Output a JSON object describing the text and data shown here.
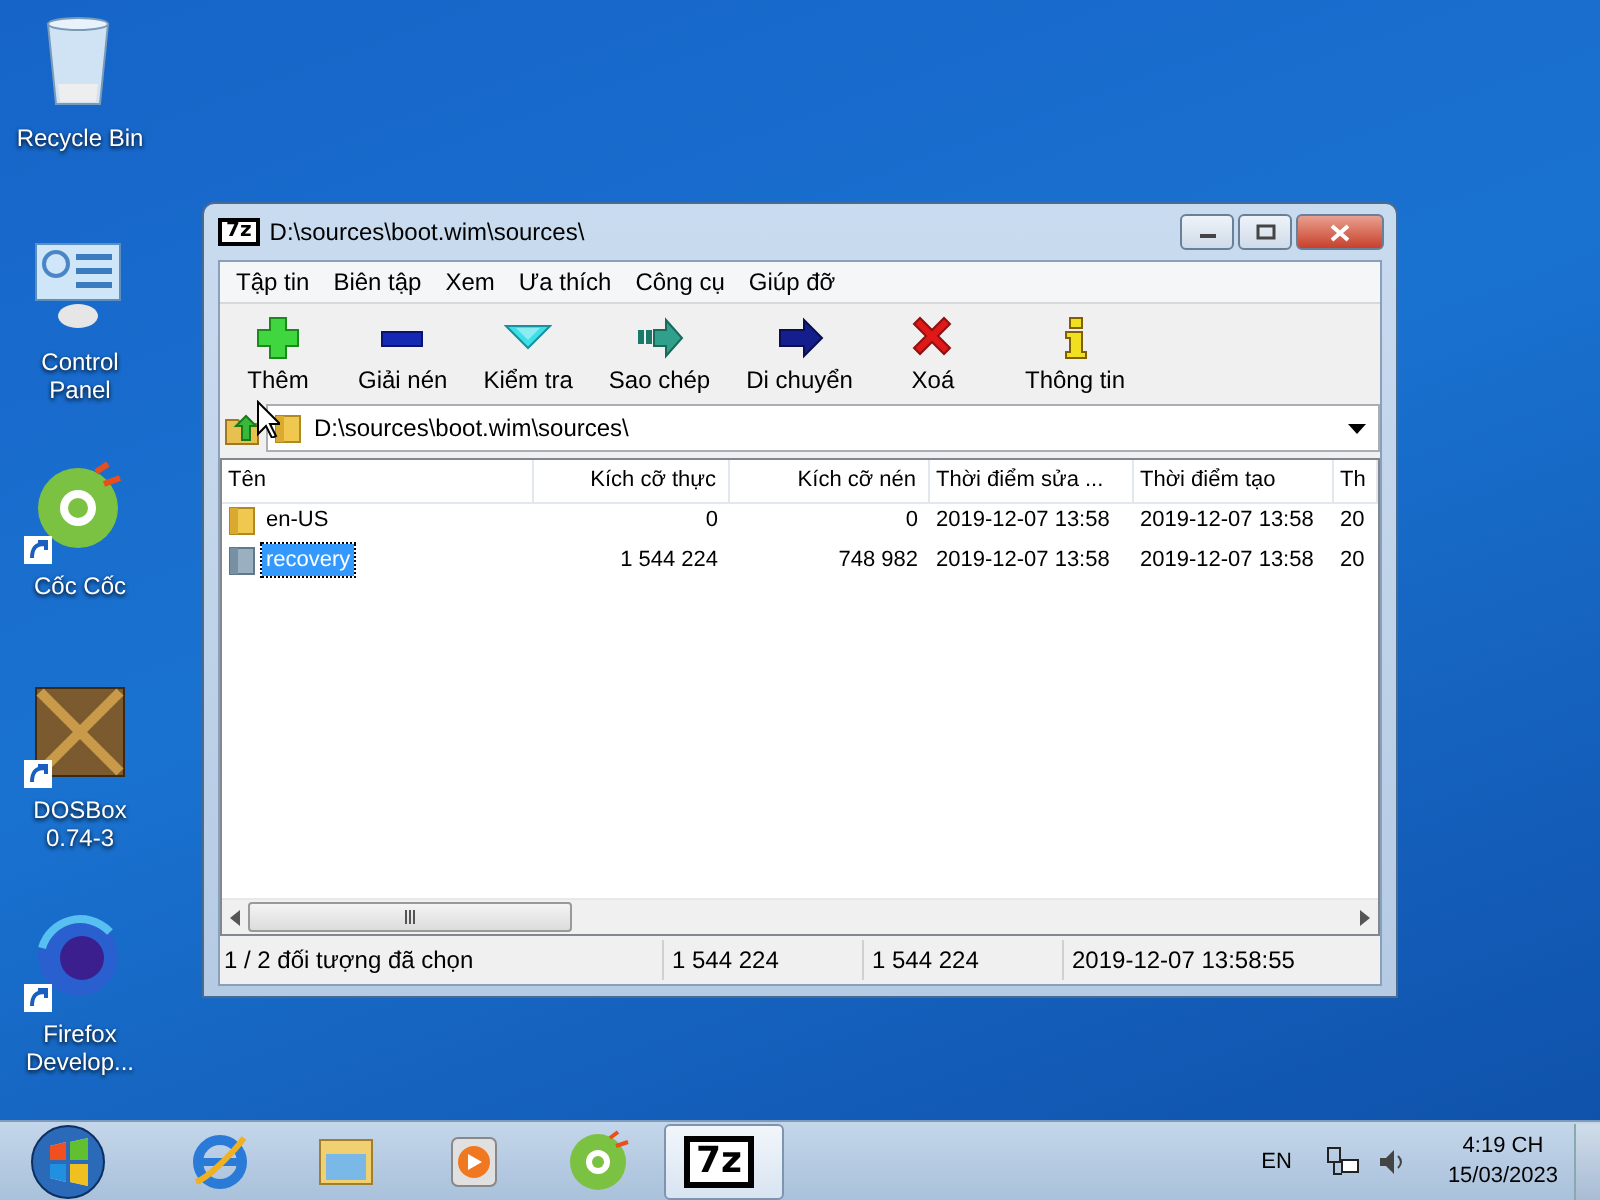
{
  "desktop_icons": [
    {
      "label": "Recycle Bin",
      "kind": "recycle",
      "shortcut": false
    },
    {
      "label": "Control Panel",
      "kind": "control",
      "shortcut": false
    },
    {
      "label": "Cốc Cốc",
      "kind": "coccoc",
      "shortcut": true
    },
    {
      "label": "DOSBox 0.74-3",
      "kind": "dosbox",
      "shortcut": true
    },
    {
      "label": "Firefox Develop...",
      "kind": "firefox",
      "shortcut": true
    }
  ],
  "window": {
    "logo": "7z",
    "title": "D:\\sources\\boot.wim\\sources\\",
    "menu": [
      "Tập tin",
      "Biên tập",
      "Xem",
      "Ưa thích",
      "Công cụ",
      "Giúp đỡ"
    ],
    "toolbar": [
      {
        "label": "Thêm",
        "kind": "add"
      },
      {
        "label": "Giải nén",
        "kind": "extract"
      },
      {
        "label": "Kiểm tra",
        "kind": "test"
      },
      {
        "label": "Sao chép",
        "kind": "copy"
      },
      {
        "label": "Di chuyển",
        "kind": "move"
      },
      {
        "label": "Xoá",
        "kind": "delete"
      },
      {
        "label": "Thông tin",
        "kind": "info"
      }
    ],
    "address": "D:\\sources\\boot.wim\\sources\\",
    "columns": [
      "Tên",
      "Kích cỡ thực",
      "Kích cỡ nén",
      "Thời điểm sửa ...",
      "Thời điểm tạo",
      "Th"
    ],
    "rows": [
      {
        "kind": "folder",
        "selected": false,
        "cells": [
          "en-US",
          "0",
          "0",
          "2019-12-07 13:58",
          "2019-12-07 13:58",
          "20"
        ]
      },
      {
        "kind": "archive",
        "selected": true,
        "cells": [
          "recovery",
          "1 544 224",
          "748 982",
          "2019-12-07 13:58",
          "2019-12-07 13:58",
          "20"
        ]
      }
    ],
    "status_bar": [
      "1 / 2 đối tượng đã chọn",
      "1 544 224",
      "1 544 224",
      "2019-12-07 13:58:55"
    ]
  },
  "taskbar": {
    "items": [
      {
        "kind": "ie",
        "selected": false
      },
      {
        "kind": "explorer",
        "selected": false
      },
      {
        "kind": "media",
        "selected": false
      },
      {
        "kind": "coccoc",
        "selected": false
      },
      {
        "kind": "sevenzip",
        "selected": true,
        "logo": "7z"
      }
    ],
    "language": "EN",
    "time": "4:19 CH",
    "date": "15/03/2023"
  }
}
